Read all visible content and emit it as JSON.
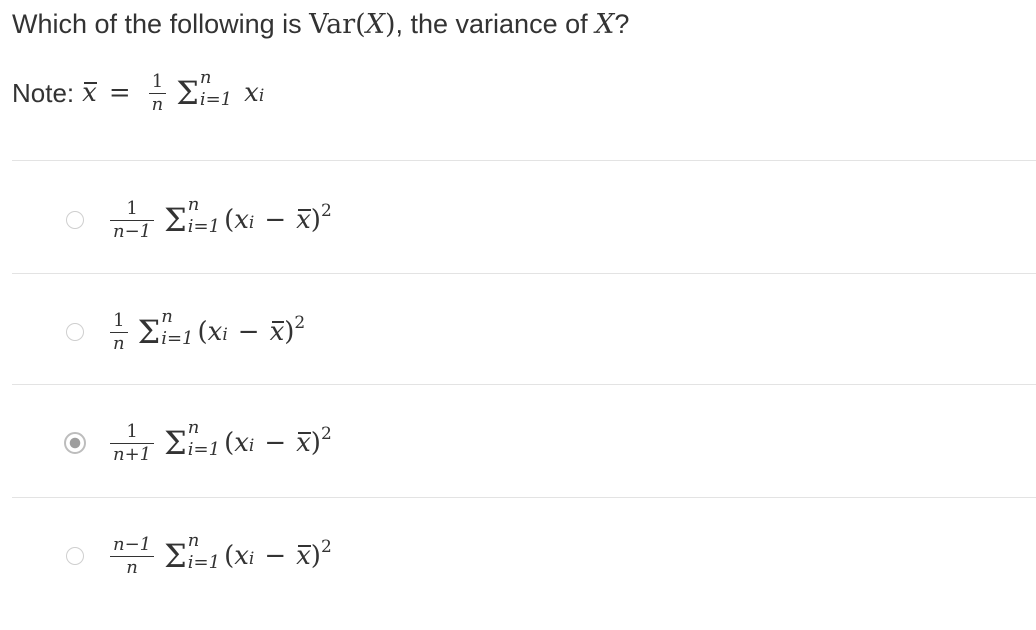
{
  "question": {
    "text_before": "Which of the following is ",
    "var_name": "Var",
    "var_open": "(",
    "var_arg": "X",
    "var_close": ")",
    "text_after": ", the variance of ",
    "x_symbol": "X",
    "question_mark": "?"
  },
  "note": {
    "label": "Note:",
    "lhs": "x",
    "equals": "=",
    "frac_num": "1",
    "frac_den": "n",
    "sigma": "Σ",
    "sum_upper": "n",
    "sum_lower": "i=1",
    "term": "x",
    "term_sub": "i"
  },
  "options": [
    {
      "frac_num": "1",
      "frac_den": "n−1",
      "sigma": "Σ",
      "sum_upper": "n",
      "sum_lower": "i=1",
      "open": "(",
      "x": "x",
      "x_sub": "i",
      "minus": "−",
      "xbar": "x",
      "close": ")",
      "power": "2",
      "selected": false
    },
    {
      "frac_num": "1",
      "frac_den": "n",
      "sigma": "Σ",
      "sum_upper": "n",
      "sum_lower": "i=1",
      "open": "(",
      "x": "x",
      "x_sub": "i",
      "minus": "−",
      "xbar": "x",
      "close": ")",
      "power": "2",
      "selected": false
    },
    {
      "frac_num": "1",
      "frac_den": "n+1",
      "sigma": "Σ",
      "sum_upper": "n",
      "sum_lower": "i=1",
      "open": "(",
      "x": "x",
      "x_sub": "i",
      "minus": "−",
      "xbar": "x",
      "close": ")",
      "power": "2",
      "selected": true
    },
    {
      "frac_num": "n−1",
      "frac_den": "n",
      "sigma": "Σ",
      "sum_upper": "n",
      "sum_lower": "i=1",
      "open": "(",
      "x": "x",
      "x_sub": "i",
      "minus": "−",
      "xbar": "x",
      "close": ")",
      "power": "2",
      "selected": false
    }
  ]
}
